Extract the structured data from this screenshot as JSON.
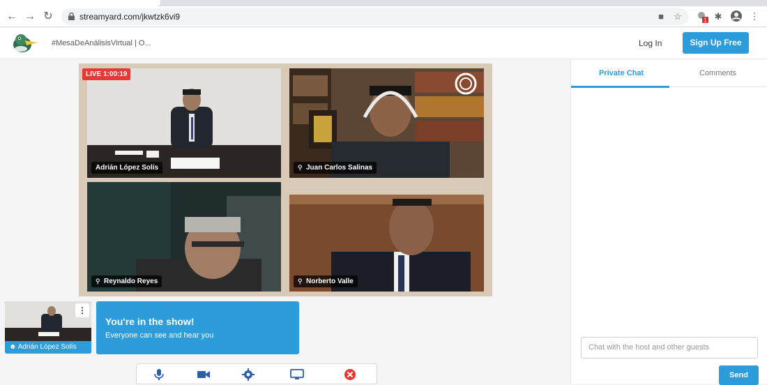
{
  "browser": {
    "url": "streamyard.com/jkwtzk6vi9",
    "ext_badge": "1"
  },
  "header": {
    "title": "#MesaDeAnálisisVirtual | O...",
    "login": "Log In",
    "signup": "Sign Up Free"
  },
  "stage": {
    "live_label": "LIVE 1:00:19",
    "participants": [
      {
        "name": "Adrián López Solís",
        "muted": false
      },
      {
        "name": "Juan Carlos Salinas",
        "muted": true
      },
      {
        "name": "Reynaldo Reyes",
        "muted": true
      },
      {
        "name": "Norberto Valle",
        "muted": true
      }
    ]
  },
  "self": {
    "name": "Adrián López Solís"
  },
  "info": {
    "heading": "You're in the show!",
    "subtext": "Everyone can see and hear you"
  },
  "chat": {
    "tabs": [
      "Private Chat",
      "Comments"
    ],
    "placeholder": "Chat with the host and other guests",
    "send": "Send"
  },
  "colors": {
    "accent": "#2d9cdb",
    "live": "#e53935"
  },
  "icons": {
    "controls": [
      "microphone-icon",
      "camera-icon",
      "settings-gear-icon",
      "screen-share-icon",
      "leave-studio-icon"
    ]
  }
}
